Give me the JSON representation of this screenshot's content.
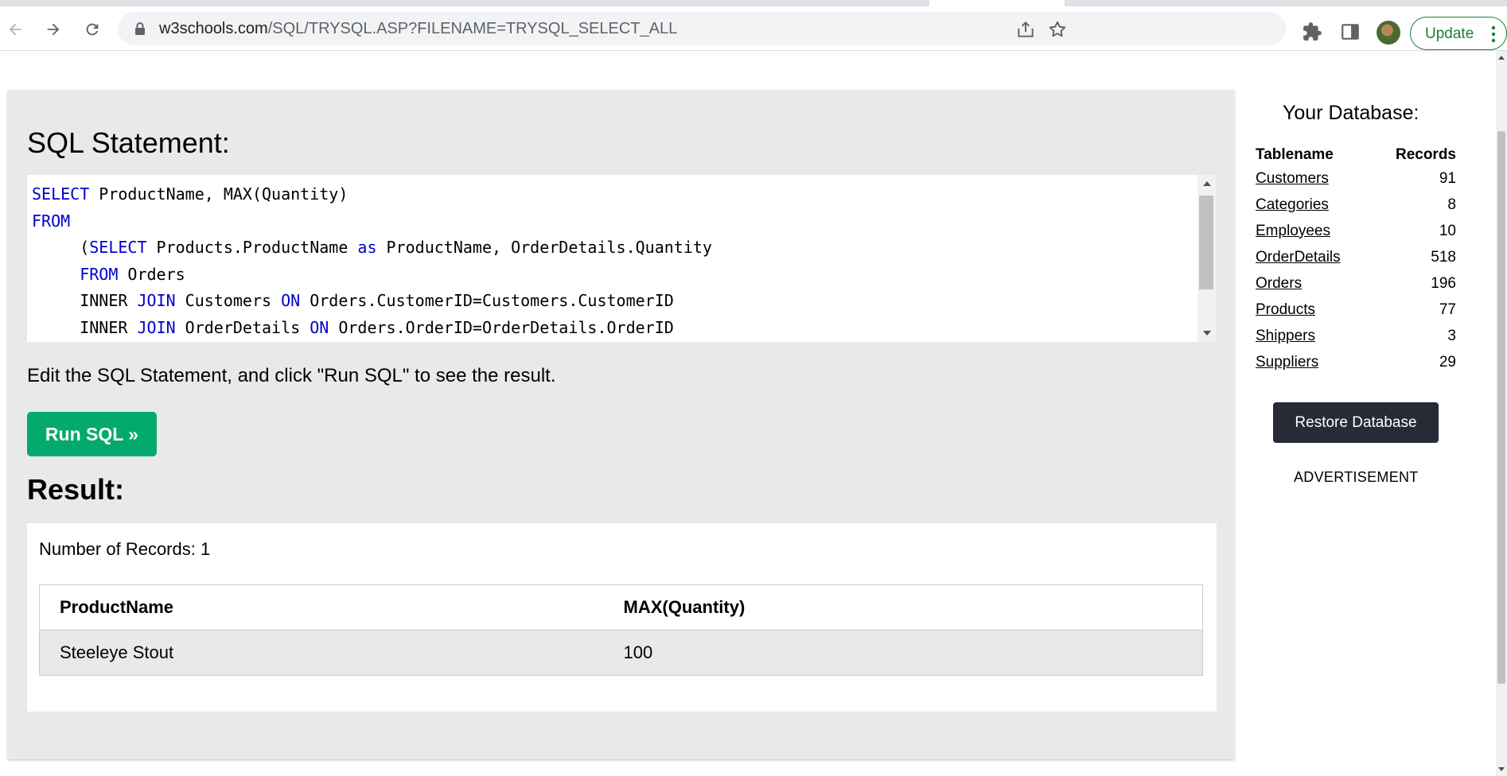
{
  "browser": {
    "url_host": "w3schools.com",
    "url_path": "/SQL/TRYSQL.ASP?FILENAME=TRYSQL_SELECT_ALL",
    "update_label": "Update"
  },
  "editor": {
    "heading": "SQL Statement:",
    "lines": [
      [
        {
          "t": "SELECT",
          "k": true
        },
        {
          "t": " ProductName, MAX(Quantity)",
          "k": false
        }
      ],
      [
        {
          "t": "FROM",
          "k": true
        }
      ],
      [
        {
          "t": "     (",
          "k": false
        },
        {
          "t": "SELECT",
          "k": true
        },
        {
          "t": " Products.ProductName ",
          "k": false
        },
        {
          "t": "as",
          "k": true
        },
        {
          "t": " ProductName, OrderDetails.Quantity",
          "k": false
        }
      ],
      [
        {
          "t": "     ",
          "k": false
        },
        {
          "t": "FROM",
          "k": true
        },
        {
          "t": " Orders",
          "k": false
        }
      ],
      [
        {
          "t": "     INNER ",
          "k": false
        },
        {
          "t": "JOIN",
          "k": true
        },
        {
          "t": " Customers ",
          "k": false
        },
        {
          "t": "ON",
          "k": true
        },
        {
          "t": " Orders.CustomerID=Customers.CustomerID",
          "k": false
        }
      ],
      [
        {
          "t": "     INNER ",
          "k": false
        },
        {
          "t": "JOIN",
          "k": true
        },
        {
          "t": " OrderDetails ",
          "k": false
        },
        {
          "t": "ON",
          "k": true
        },
        {
          "t": " Orders.OrderID=OrderDetails.OrderID",
          "k": false
        }
      ]
    ],
    "hint": "Edit the SQL Statement, and click \"Run SQL\" to see the result.",
    "run_label": "Run SQL »"
  },
  "result": {
    "heading": "Result:",
    "record_count": "Number of Records: 1",
    "columns": [
      "ProductName",
      "MAX(Quantity)"
    ],
    "rows": [
      [
        "Steeleye Stout",
        "100"
      ]
    ]
  },
  "sidebar": {
    "title": "Your Database:",
    "col_name": "Tablename",
    "col_records": "Records",
    "tables": [
      {
        "name": "Customers",
        "records": "91"
      },
      {
        "name": "Categories",
        "records": "8"
      },
      {
        "name": "Employees",
        "records": "10"
      },
      {
        "name": "OrderDetails",
        "records": "518"
      },
      {
        "name": "Orders",
        "records": "196"
      },
      {
        "name": "Products",
        "records": "77"
      },
      {
        "name": "Shippers",
        "records": "3"
      },
      {
        "name": "Suppliers",
        "records": "29"
      }
    ],
    "restore_label": "Restore Database",
    "advertisement": "ADVERTISEMENT"
  },
  "colors": {
    "run_button": "#04aa6d",
    "restore_button": "#282a35",
    "panel_bg": "#e7e9eb",
    "sql_keyword": "#0000cd",
    "update_green": "#188038"
  },
  "icons": [
    "back-arrow-icon",
    "forward-arrow-icon",
    "reload-icon",
    "lock-icon",
    "share-icon",
    "star-icon",
    "extensions-puzzle-icon",
    "side-panel-icon",
    "avatar",
    "more-vert-icon"
  ]
}
